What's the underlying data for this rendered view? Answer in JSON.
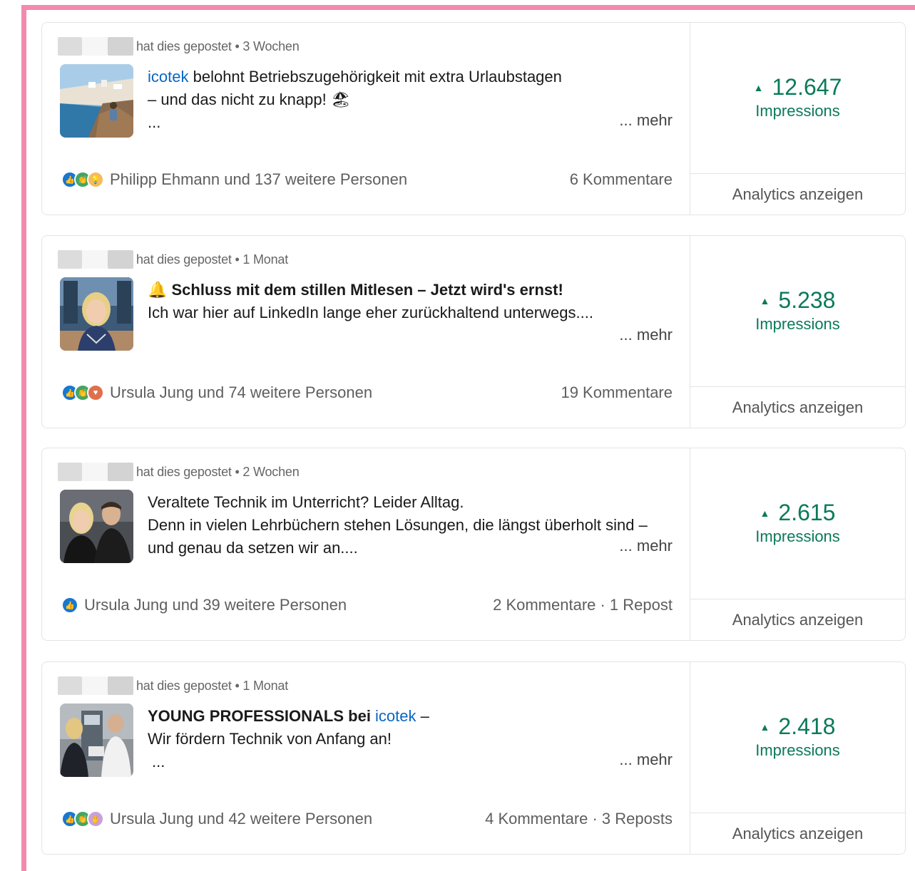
{
  "posts": [
    {
      "meta": "hat dies gepostet • 3 Wochen",
      "text_parts": {
        "link": "icotek",
        "l1": " belohnt Betriebszugehörigkeit mit extra Urlaubstagen",
        "l2": "– und das nicht zu knapp! 🏖",
        "l3": "..."
      },
      "more": "... mehr",
      "reactions_text": "Philipp Ehmann und 137 weitere Personen",
      "comments": "6 Kommentare",
      "impressions_value": "12.647",
      "impressions_label": "Impressions",
      "analytics": "Analytics anzeigen"
    },
    {
      "meta": "hat dies gepostet • 1 Monat",
      "text_parts": {
        "l1": "🔔 Schluss mit dem stillen Mitlesen – Jetzt wird's ernst!",
        "l2": "",
        "l3": "Ich war hier auf LinkedIn lange eher zurückhaltend unterwegs...."
      },
      "more": "... mehr",
      "reactions_text": "Ursula Jung und 74 weitere Personen",
      "comments": "19 Kommentare",
      "impressions_value": "5.238",
      "impressions_label": "Impressions",
      "analytics": "Analytics anzeigen"
    },
    {
      "meta": "hat dies gepostet • 2 Wochen",
      "text_parts": {
        "l1": "Veraltete Technik im Unterricht? Leider Alltag.",
        "l2": "Denn in vielen Lehrbüchern stehen Lösungen, die längst überholt sind –",
        "l3": "und genau da setzen wir an...."
      },
      "more": "... mehr",
      "reactions_text": "Ursula Jung und 39 weitere Personen",
      "comments": "2 Kommentare · 1 Repost",
      "impressions_value": "2.615",
      "impressions_label": "Impressions",
      "analytics": "Analytics anzeigen"
    },
    {
      "meta": "hat dies gepostet • 1 Monat",
      "text_parts": {
        "bold": "YOUNG PROFESSIONALS bei ",
        "link": "icotek",
        "l1_end": " –",
        "l2": "Wir fördern Technik von Anfang an!",
        "l3": "..."
      },
      "more": "... mehr",
      "reactions_text": "Ursula Jung und 42 weitere Personen",
      "comments": "4 Kommentare · 3 Reposts",
      "impressions_value": "2.418",
      "impressions_label": "Impressions",
      "analytics": "Analytics anzeigen"
    }
  ],
  "icons": {
    "arrow": "triangle-up-icon",
    "reaction_sets": [
      [
        "like",
        "celebrate",
        "insight"
      ],
      [
        "like",
        "celebrate",
        "love"
      ],
      [
        "like"
      ],
      [
        "like",
        "celebrate",
        "support"
      ]
    ]
  },
  "colors": {
    "accent_green": "#0a7a5a",
    "link_blue": "#0a66c2",
    "frame_pink": "#f28aae"
  }
}
